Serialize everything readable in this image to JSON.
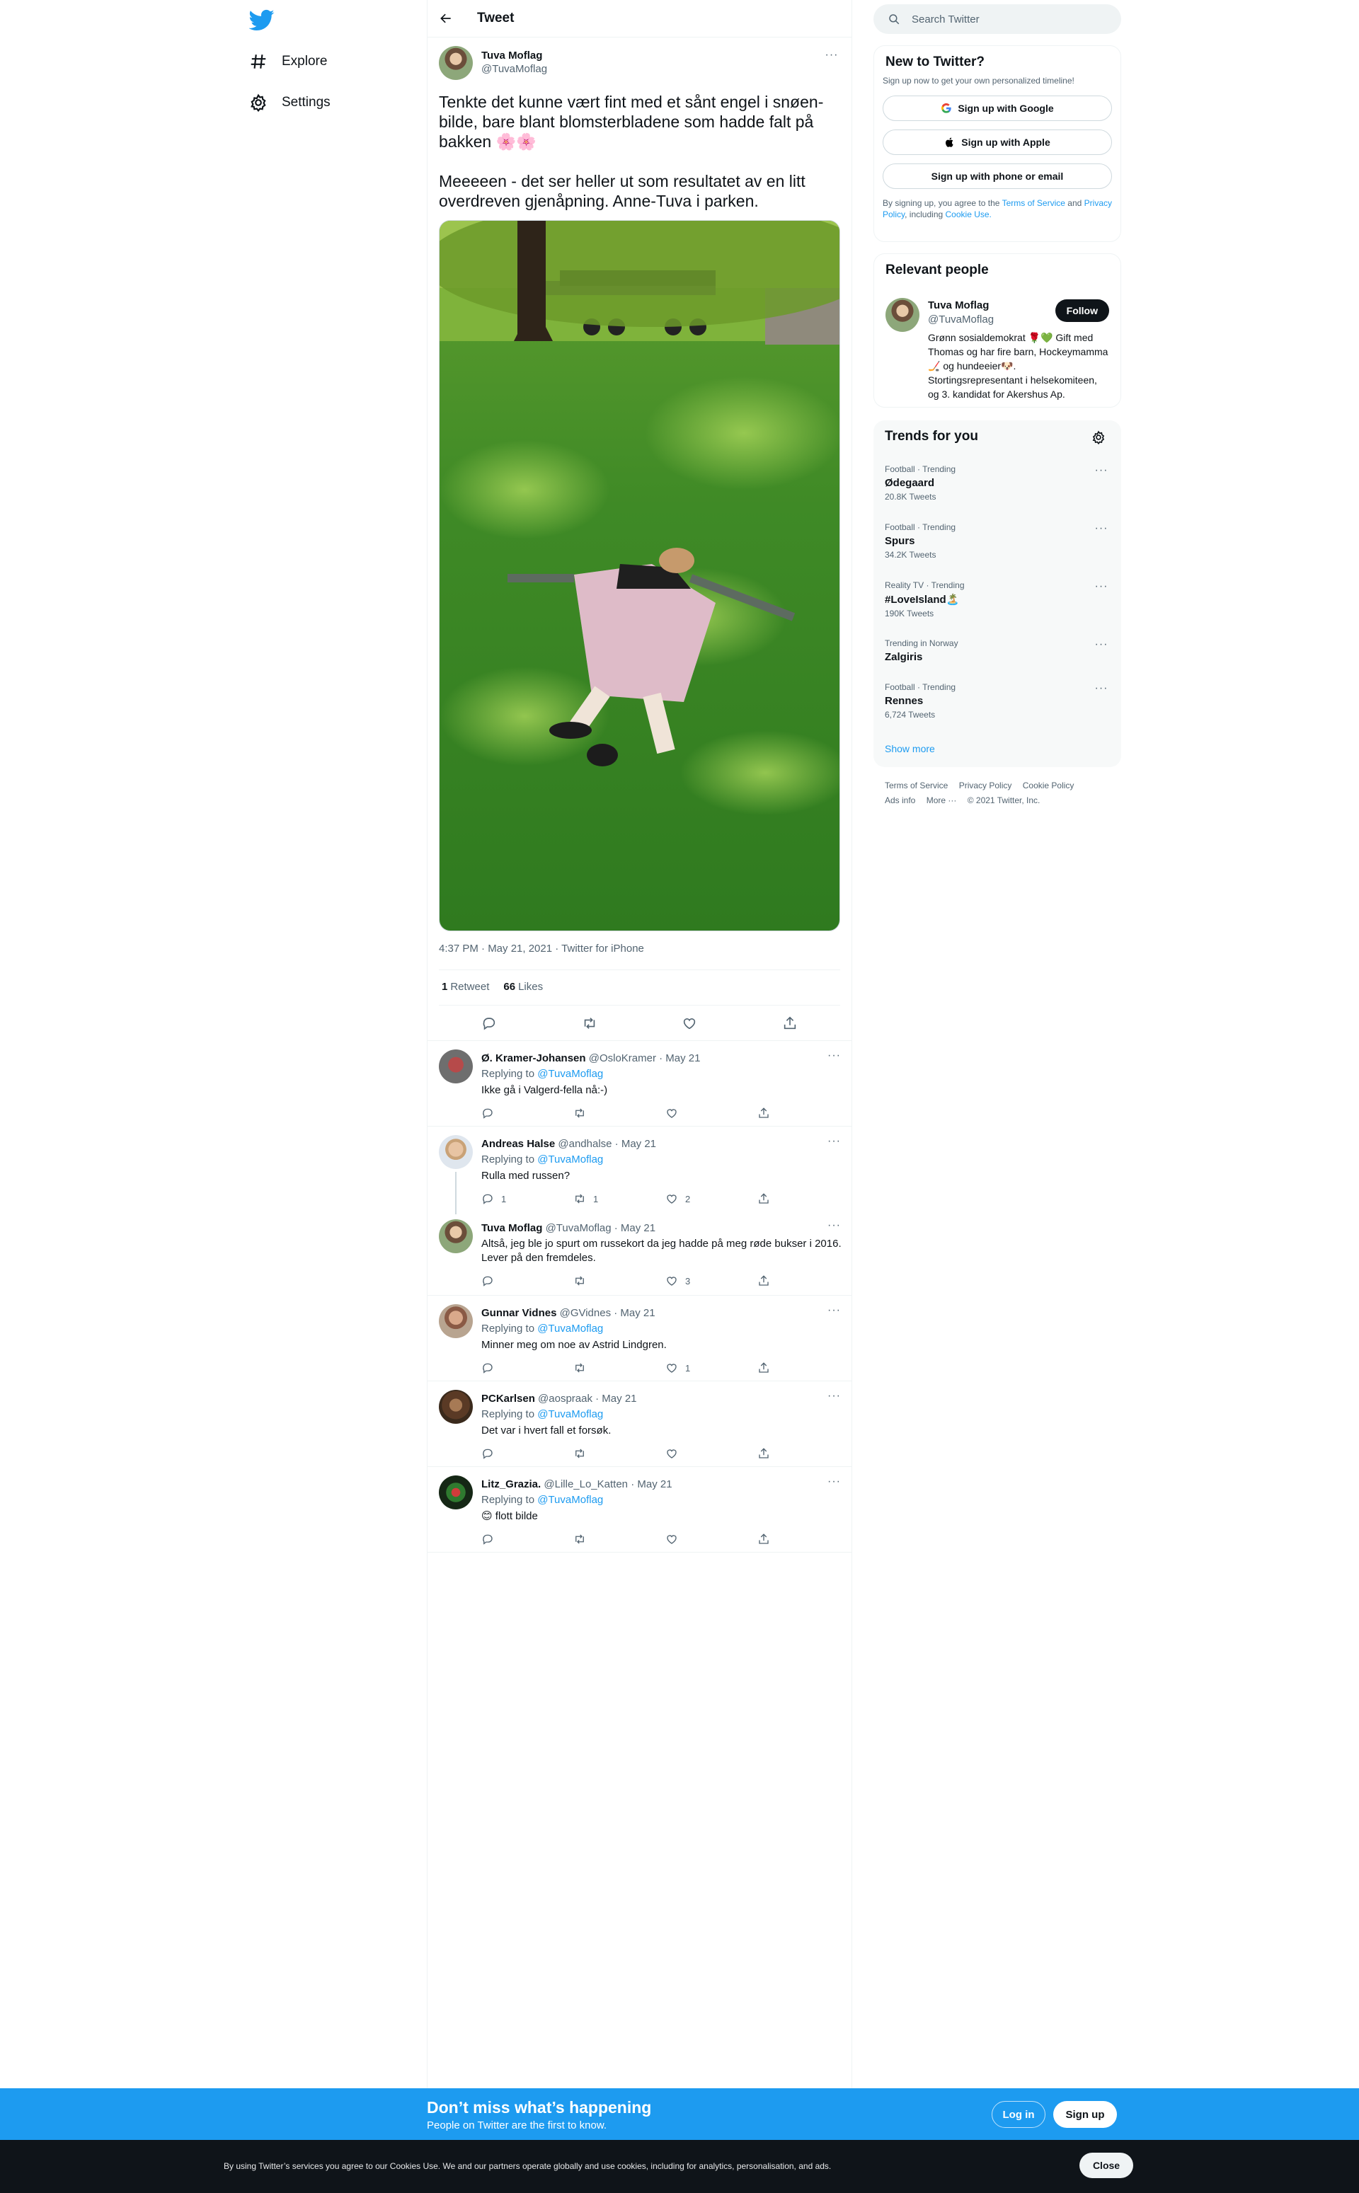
{
  "nav": {
    "items": [
      {
        "label": "Explore",
        "icon": "hashtag-icon"
      },
      {
        "label": "Settings",
        "icon": "gear-icon"
      }
    ]
  },
  "header": {
    "title": "Tweet"
  },
  "tweet": {
    "name": "Tuva Moflag",
    "handle": "@TuvaMoflag",
    "text": "Tenkte det kunne vært fint med et sånt engel i snøen-bilde, bare blant blomsterbladene som hadde falt på bakken 🌸🌸\n\nMeeeeen - det ser heller ut som resultatet av en litt overdreven gjenåpning. Anne-Tuva i parken.",
    "time": "4:37 PM · May 21, 2021",
    "source": "Twitter for iPhone",
    "retweets": "1",
    "retweets_label": "Retweet",
    "likes": "66",
    "likes_label": "Likes"
  },
  "replies": [
    {
      "name": "Ø. Kramer-Johansen",
      "handle": "@OsloKramer · May 21",
      "replying_prefix": "Replying to",
      "replying_to": "@TuvaMoflag",
      "text": "Ikke gå i Valgerd-fella nå:-)",
      "reply_count": "",
      "retweet_count": "",
      "like_count": ""
    },
    {
      "name": "Andreas Halse",
      "handle": "@andhalse · May 21",
      "replying_prefix": "Replying to",
      "replying_to": "@TuvaMoflag",
      "text": "Rulla med russen?",
      "reply_count": "1",
      "retweet_count": "1",
      "like_count": "2"
    },
    {
      "name": "Tuva Moflag",
      "handle": "@TuvaMoflag · May 21",
      "text": "Altså, jeg ble jo spurt om russekort da jeg hadde på meg røde bukser i 2016. Lever på den fremdeles.",
      "reply_count": "",
      "retweet_count": "",
      "like_count": "3"
    },
    {
      "name": "Gunnar Vidnes",
      "handle": "@GVidnes · May 21",
      "replying_prefix": "Replying to",
      "replying_to": "@TuvaMoflag",
      "text": "Minner meg om noe av Astrid Lindgren.",
      "reply_count": "",
      "retweet_count": "",
      "like_count": "1"
    },
    {
      "name": "PCKarlsen",
      "handle": "@aospraak · May 21",
      "replying_prefix": "Replying to",
      "replying_to": "@TuvaMoflag",
      "text": "Det var i hvert fall et forsøk.",
      "reply_count": "",
      "retweet_count": "",
      "like_count": ""
    },
    {
      "name": "Litz_Grazia.",
      "handle": "@Lille_Lo_Katten · May 21",
      "replying_prefix": "Replying to",
      "replying_to": "@TuvaMoflag",
      "text": "😊 flott bilde",
      "reply_count": "",
      "retweet_count": "",
      "like_count": ""
    }
  ],
  "search": {
    "placeholder": "Search Twitter"
  },
  "new_to_twitter": {
    "title": "New to Twitter?",
    "subtitle": "Sign up now to get your own personalized timeline!",
    "google": "Sign up with Google",
    "apple": "Sign up with Apple",
    "phone": "Sign up with phone or email",
    "legal_1": "By signing up, you agree to the",
    "terms": "Terms of Service",
    "legal_and": "and",
    "privacy": "Privacy Policy",
    "legal_2": ", including",
    "cookie": "Cookie Use."
  },
  "relevant": {
    "title": "Relevant people",
    "name": "Tuva Moflag",
    "handle": "@TuvaMoflag",
    "follow": "Follow",
    "bio": "Grønn sosialdemokrat 🌹💚 Gift med Thomas og har fire barn, Hockeymamma🏒 og hundeeier🐶. Stortingsrepresentant i helsekomiteen, og 3. kandidat for Akershus Ap."
  },
  "trends": {
    "title": "Trends for you",
    "items": [
      {
        "context": "Football · Trending",
        "name": "Ødegaard",
        "count": "20.8K Tweets"
      },
      {
        "context": "Football · Trending",
        "name": "Spurs",
        "count": "34.2K Tweets"
      },
      {
        "context": "Reality TV · Trending",
        "name": "#LoveIsland🏝️",
        "count": "190K Tweets"
      },
      {
        "context": "Trending in Norway",
        "name": "Zalgiris",
        "count": ""
      },
      {
        "context": "Football · Trending",
        "name": "Rennes",
        "count": "6,724 Tweets"
      }
    ],
    "show_more": "Show more"
  },
  "footer": {
    "terms": "Terms of Service",
    "privacy": "Privacy Policy",
    "cookie": "Cookie Policy",
    "ads": "Ads info",
    "more": "More ···",
    "copyright": "© 2021 Twitter, Inc."
  },
  "bottom_bar": {
    "heading": "Don’t miss what’s happening",
    "sub": "People on Twitter are the first to know.",
    "login": "Log in",
    "signup": "Sign up"
  },
  "cookie_bar": {
    "text": "By using Twitter’s services you agree to our Cookies Use. We and our partners operate globally and use cookies, including for analytics, personalisation, and ads.",
    "close": "Close"
  },
  "colors": {
    "accent": "#1d9bf0",
    "text": "#0f1419",
    "muted": "#536471",
    "border": "#eff3f4"
  }
}
